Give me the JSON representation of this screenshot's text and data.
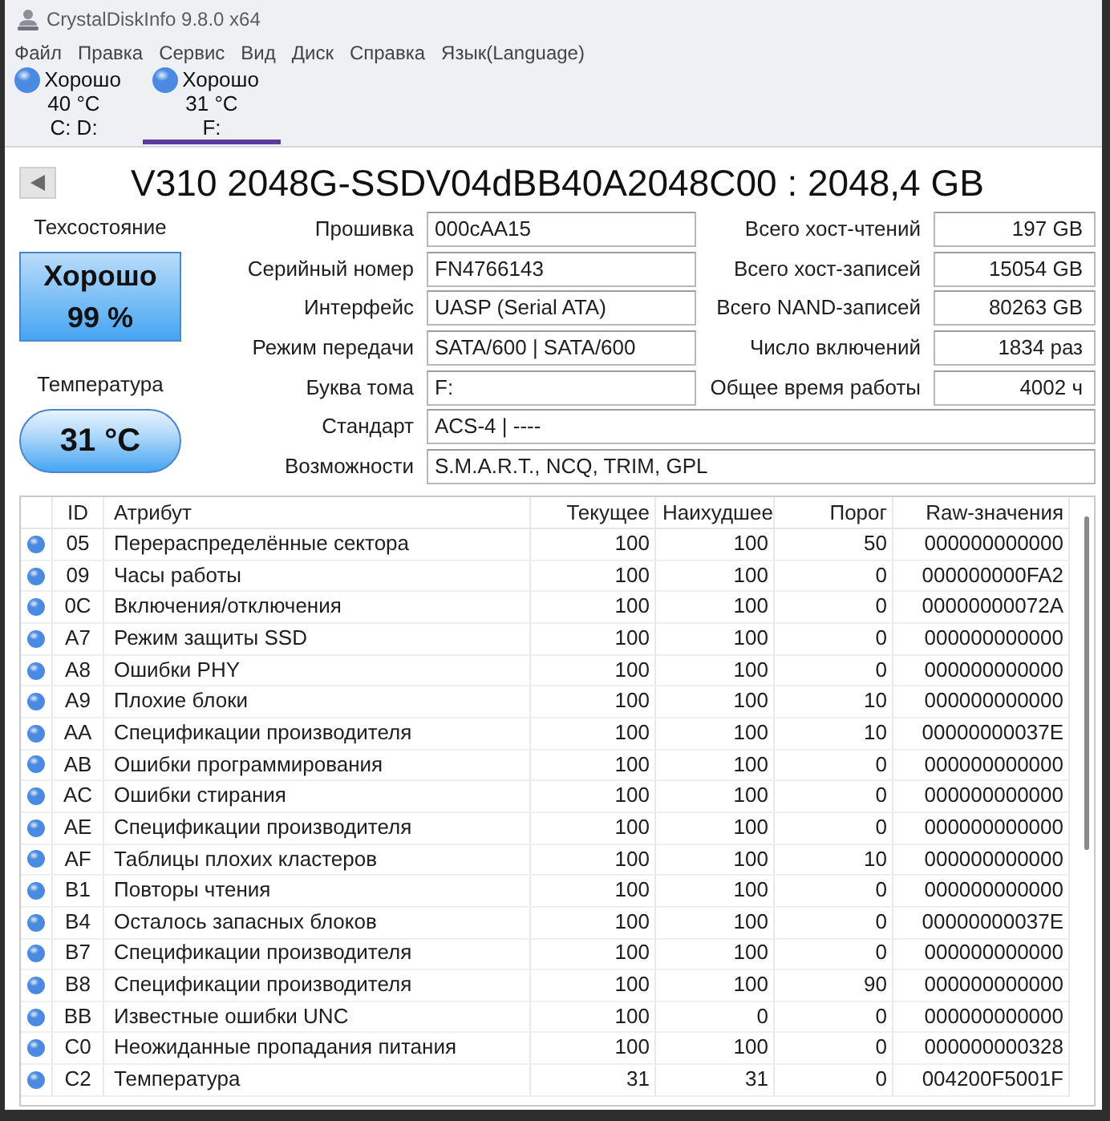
{
  "window": {
    "title": "CrystalDiskInfo 9.8.0 x64"
  },
  "menu": [
    "Файл",
    "Правка",
    "Сервис",
    "Вид",
    "Диск",
    "Справка",
    "Язык(Language)"
  ],
  "drives": [
    {
      "color": "#4a8ae0",
      "status": "Хорошо",
      "temperature": "40 °C",
      "letters": "C: D:",
      "selected": false
    },
    {
      "color": "#4a8ae0",
      "status": "Хорошо",
      "temperature": "31 °C",
      "letters": "F:",
      "selected": true
    }
  ],
  "disk": {
    "title": "V310 2048G-SSDV04dBB40A2048C00 : 2048,4 GB"
  },
  "health": {
    "label": "Техсостояние",
    "status": "Хорошо",
    "percent": "99 %"
  },
  "temperature": {
    "label": "Температура",
    "value": "31 °C"
  },
  "details_left": [
    {
      "label": "Прошивка",
      "value": "000cAA15"
    },
    {
      "label": "Серийный номер",
      "value": "FN4766143"
    },
    {
      "label": "Интерфейс",
      "value": "UASP (Serial ATA)"
    },
    {
      "label": "Режим передачи",
      "value": "SATA/600 | SATA/600"
    },
    {
      "label": "Буква тома",
      "value": "F:"
    }
  ],
  "details_right": [
    {
      "label": "Всего хост-чтений",
      "value": "197 GB"
    },
    {
      "label": "Всего хост-записей",
      "value": "15054 GB"
    },
    {
      "label": "Всего NAND-записей",
      "value": "80263 GB"
    },
    {
      "label": "Число включений",
      "value": "1834 раз"
    },
    {
      "label": "Общее время работы",
      "value": "4002 ч"
    }
  ],
  "details_wide": [
    {
      "label": "Стандарт",
      "value": "ACS-4 | ----"
    },
    {
      "label": "Возможности",
      "value": "S.M.A.R.T., NCQ, TRIM, GPL"
    }
  ],
  "smart_table": {
    "columns": [
      "ID",
      "Атрибут",
      "Текущее",
      "Наихудшее",
      "Порог",
      "Raw-значения"
    ],
    "rows": [
      {
        "color": "#4a8ae0",
        "id": "05",
        "attribute": "Перераспределённые сектора",
        "current": "100",
        "worst": "100",
        "threshold": "50",
        "raw": "000000000000"
      },
      {
        "color": "#4a8ae0",
        "id": "09",
        "attribute": "Часы работы",
        "current": "100",
        "worst": "100",
        "threshold": "0",
        "raw": "000000000FA2"
      },
      {
        "color": "#4a8ae0",
        "id": "0C",
        "attribute": "Включения/отключения",
        "current": "100",
        "worst": "100",
        "threshold": "0",
        "raw": "00000000072A"
      },
      {
        "color": "#4a8ae0",
        "id": "A7",
        "attribute": "Режим защиты SSD",
        "current": "100",
        "worst": "100",
        "threshold": "0",
        "raw": "000000000000"
      },
      {
        "color": "#4a8ae0",
        "id": "A8",
        "attribute": "Ошибки PHY",
        "current": "100",
        "worst": "100",
        "threshold": "0",
        "raw": "000000000000"
      },
      {
        "color": "#4a8ae0",
        "id": "A9",
        "attribute": "Плохие блоки",
        "current": "100",
        "worst": "100",
        "threshold": "10",
        "raw": "000000000000"
      },
      {
        "color": "#4a8ae0",
        "id": "AA",
        "attribute": "Спецификации производителя",
        "current": "100",
        "worst": "100",
        "threshold": "10",
        "raw": "00000000037E"
      },
      {
        "color": "#4a8ae0",
        "id": "AB",
        "attribute": "Ошибки программирования",
        "current": "100",
        "worst": "100",
        "threshold": "0",
        "raw": "000000000000"
      },
      {
        "color": "#4a8ae0",
        "id": "AC",
        "attribute": "Ошибки стирания",
        "current": "100",
        "worst": "100",
        "threshold": "0",
        "raw": "000000000000"
      },
      {
        "color": "#4a8ae0",
        "id": "AE",
        "attribute": "Спецификации производителя",
        "current": "100",
        "worst": "100",
        "threshold": "0",
        "raw": "000000000000"
      },
      {
        "color": "#4a8ae0",
        "id": "AF",
        "attribute": "Таблицы плохих кластеров",
        "current": "100",
        "worst": "100",
        "threshold": "10",
        "raw": "000000000000"
      },
      {
        "color": "#4a8ae0",
        "id": "B1",
        "attribute": "Повторы чтения",
        "current": "100",
        "worst": "100",
        "threshold": "0",
        "raw": "000000000000"
      },
      {
        "color": "#4a8ae0",
        "id": "B4",
        "attribute": "Осталось запасных блоков",
        "current": "100",
        "worst": "100",
        "threshold": "0",
        "raw": "00000000037E"
      },
      {
        "color": "#4a8ae0",
        "id": "B7",
        "attribute": "Спецификации производителя",
        "current": "100",
        "worst": "100",
        "threshold": "0",
        "raw": "000000000000"
      },
      {
        "color": "#4a8ae0",
        "id": "B8",
        "attribute": "Спецификации производителя",
        "current": "100",
        "worst": "100",
        "threshold": "90",
        "raw": "000000000000"
      },
      {
        "color": "#4a8ae0",
        "id": "BB",
        "attribute": "Известные ошибки UNC",
        "current": "100",
        "worst": "0",
        "threshold": "0",
        "raw": "000000000000"
      },
      {
        "color": "#4a8ae0",
        "id": "C0",
        "attribute": "Неожиданные пропадания питания",
        "current": "100",
        "worst": "100",
        "threshold": "0",
        "raw": "000000000328"
      },
      {
        "color": "#4a8ae0",
        "id": "C2",
        "attribute": "Температура",
        "current": "31",
        "worst": "31",
        "threshold": "0",
        "raw": "004200F5001F"
      }
    ]
  }
}
